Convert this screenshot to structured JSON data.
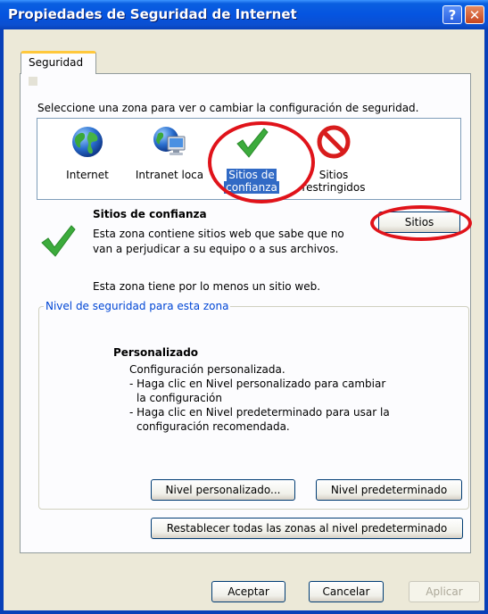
{
  "window": {
    "title": "Propiedades de Seguridad de Internet",
    "help_glyph": "?",
    "close_glyph": "✕"
  },
  "tabs": [
    {
      "label": "Seguridad"
    }
  ],
  "instruction": "Seleccione una zona para ver o cambiar la configuración de seguridad.",
  "zones": [
    {
      "label": "Internet",
      "icon": "globe-icon"
    },
    {
      "label": "Intranet loca",
      "icon": "intranet-icon"
    },
    {
      "label_line1": "Sitios de",
      "label_line2": "confianza",
      "icon": "check-icon",
      "selected": true
    },
    {
      "label_line1": "Sitios",
      "label_line2": "restringidos",
      "icon": "restricted-icon"
    }
  ],
  "selected_zone": {
    "title": "Sitios de confianza",
    "desc_line1": "Esta zona contiene sitios web que sabe que no",
    "desc_line2": "van a perjudicar a su equipo o a sus archivos.",
    "note": "Esta zona tiene por lo menos un sitio web.",
    "sites_button": "Sitios"
  },
  "security_level": {
    "legend": "Nivel de seguridad para esta zona",
    "title": "Personalizado",
    "lines": [
      "Configuración personalizada.",
      "- Haga clic en Nivel personalizado para cambiar",
      "la configuración",
      "- Haga clic en Nivel predeterminado para usar la",
      "configuración recomendada."
    ],
    "custom_button": "Nivel personalizado...",
    "default_button": "Nivel predeterminado"
  },
  "reset_button": "Restablecer todas las zonas al nivel predeterminado",
  "footer": {
    "ok": "Aceptar",
    "cancel": "Cancelar",
    "apply": "Aplicar"
  },
  "colors": {
    "selection": "#316ac5",
    "annotation": "#e0131a",
    "legend": "#0046d5"
  }
}
